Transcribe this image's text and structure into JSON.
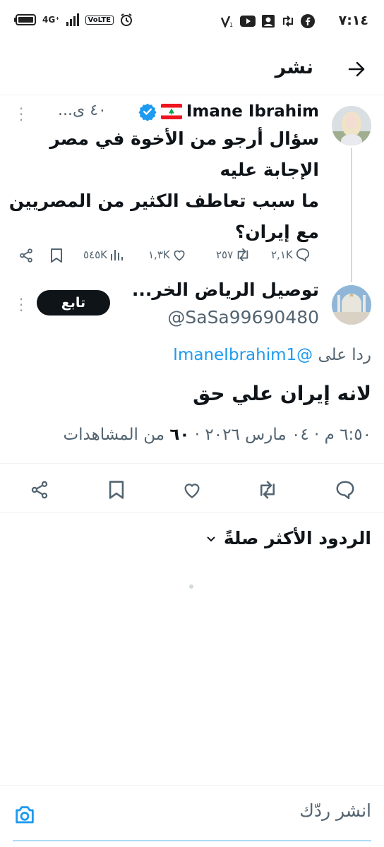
{
  "status_bar": {
    "time": "٧:١٤",
    "network": "4G⁺",
    "volte": "VoLTE",
    "icons": [
      "battery-icon",
      "signal-icon",
      "alarm-icon",
      "more-dots",
      "vodafone-icon",
      "youtube-icon",
      "contacts-icon",
      "retweet-icon",
      "facebook-icon"
    ]
  },
  "header": {
    "title": "نشر",
    "back_icon": "arrow-right-icon"
  },
  "original_tweet": {
    "author_name": "Imane Ibrahim",
    "flag": "🇱🇧",
    "verified": true,
    "time_ago": "...٤٠ ى",
    "text_lines": [
      "سؤال أرجو من الأخوة في مصر",
      "الإجابة عليه",
      "ما سبب تعاطف الكثير من المصريين",
      "مع إيران؟"
    ],
    "stats": {
      "replies": "٢,١K",
      "retweets": "٢٥٧",
      "likes": "١,٣K",
      "views": "٥٤٥K"
    }
  },
  "reply_tweet": {
    "author_name": "توصيل الرياض الخر...",
    "handle": "@SaSa99690480",
    "follow_label": "تابع",
    "reply_to_label": "ردا على",
    "reply_to_handle": "@ImaneIbrahim1",
    "text": "لانه  إيران  علي حق",
    "meta_time": "٦:٥٠ م",
    "meta_sep": "·",
    "meta_date": "٠٤ مارس ٢٠٢٦",
    "meta_views_count": "٦٠",
    "meta_views_label": "من المشاهدات"
  },
  "sort": {
    "label": "الردود الأكثر صلةً"
  },
  "composer": {
    "placeholder": "انشر ردّك"
  },
  "colors": {
    "accent": "#1d9bf0",
    "text": "#0f1419",
    "muted": "#536471",
    "divider": "#eff3f4"
  }
}
